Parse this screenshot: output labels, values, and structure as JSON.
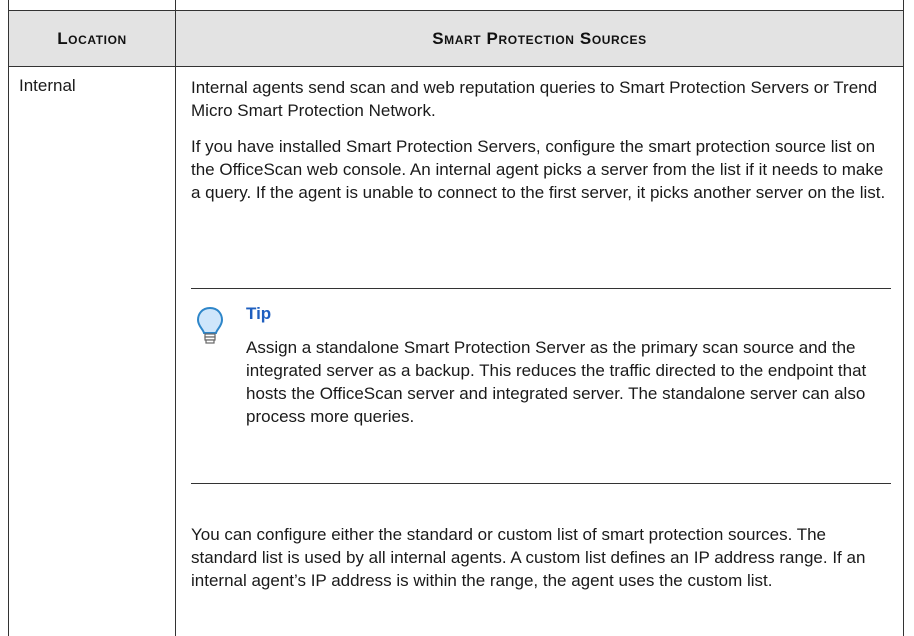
{
  "table": {
    "headers": {
      "location": "Location",
      "sources": "Smart Protection Sources"
    },
    "row": {
      "location": "Internal",
      "paragraphs": [
        "Internal agents send scan and web reputation queries to Smart Protection Servers or Trend Micro Smart Protection Network.",
        "If you have installed Smart Protection Servers, configure the smart protection source list on the OfficeScan web console. An internal agent picks a server from the list if it needs to make a query. If the agent is unable to connect to the first server, it picks another server on the list."
      ],
      "tip": {
        "icon": "lightbulb-icon",
        "title": "Tip",
        "body": "Assign a standalone Smart Protection Server as the primary scan source and the integrated server as a backup. This reduces the traffic directed to the endpoint that hosts the OfficeScan server and integrated server. The standalone server can also process more queries."
      },
      "final_paragraph": "You can configure either the standard or custom list of smart protection sources. The standard list is used by all internal agents. A custom list defines an IP address range. If an internal agent’s IP address is within the range, the agent uses the custom list."
    }
  },
  "colors": {
    "header_bg": "#e3e3e3",
    "tip_title": "#1f5fbf",
    "icon_fill": "#cfe6fb",
    "icon_stroke": "#2e86c9"
  }
}
